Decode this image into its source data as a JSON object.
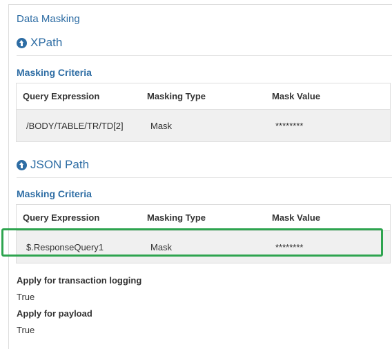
{
  "page_title": "Data Masking",
  "xpath": {
    "heading": "XPath",
    "criteria_label": "Masking Criteria",
    "columns": [
      "Query Expression",
      "Masking Type",
      "Mask Value"
    ],
    "rows": [
      {
        "query": "/BODY/TABLE/TR/TD[2]",
        "type": "Mask",
        "value": "********"
      }
    ]
  },
  "json_path": {
    "heading": "JSON Path",
    "criteria_label": "Masking Criteria",
    "columns": [
      "Query Expression",
      "Masking Type",
      "Mask Value"
    ],
    "rows": [
      {
        "query": "$.ResponseQuery1",
        "type": "Mask",
        "value": "********"
      }
    ]
  },
  "options": {
    "transaction_logging_label": "Apply for transaction logging",
    "transaction_logging_value": "True",
    "payload_label": "Apply for payload",
    "payload_value": "True"
  },
  "colors": {
    "accent": "#2e6da4",
    "highlight": "#2ea44f",
    "row_bg": "#f0f0f0"
  }
}
